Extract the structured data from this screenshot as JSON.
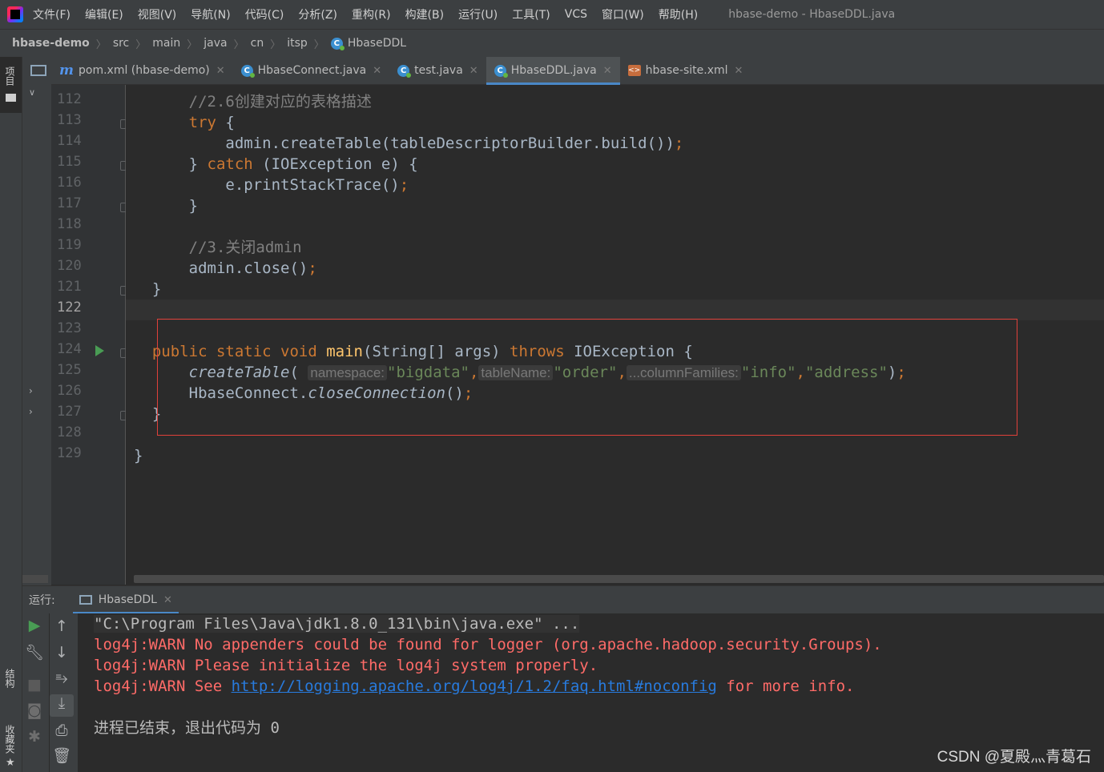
{
  "menu": {
    "items": [
      "文件(F)",
      "编辑(E)",
      "视图(V)",
      "导航(N)",
      "代码(C)",
      "分析(Z)",
      "重构(R)",
      "构建(B)",
      "运行(U)",
      "工具(T)",
      "VCS",
      "窗口(W)",
      "帮助(H)"
    ],
    "window_title": "hbase-demo - HbaseDDL.java"
  },
  "breadcrumb": {
    "root": "hbase-demo",
    "parts": [
      "src",
      "main",
      "java",
      "cn",
      "itsp"
    ],
    "current": "HbaseDDL"
  },
  "left_strip": {
    "project": "项目",
    "structure": "结构",
    "favorites": "收藏夹"
  },
  "tabs": [
    {
      "label": "pom.xml (hbase-demo)",
      "icon": "maven-icon"
    },
    {
      "label": "HbaseConnect.java",
      "icon": "class-icon"
    },
    {
      "label": "test.java",
      "icon": "class-icon"
    },
    {
      "label": "HbaseDDL.java",
      "icon": "class-icon",
      "active": true
    },
    {
      "label": "hbase-site.xml",
      "icon": "xml-icon"
    }
  ],
  "editor": {
    "line_numbers": [
      "112",
      "113",
      "114",
      "115",
      "116",
      "117",
      "118",
      "119",
      "120",
      "121",
      "122",
      "123",
      "124",
      "125",
      "126",
      "127",
      "128",
      "129"
    ],
    "current_line": "122",
    "lines": {
      "l112": "//2.6创建对应的表格描述",
      "l113_kw": "try",
      "l113_rest": " {",
      "l114": "admin.createTable(tableDescriptorBuilder.build())",
      "l114_semi": ";",
      "l115_a": "} ",
      "l115_kw": "catch",
      "l115_b": " (IOException e) {",
      "l116": "e.printStackTrace()",
      "l116_semi": ";",
      "l117": "}",
      "l119": "//3.关闭admin",
      "l120": "admin.close()",
      "l120_semi": ";",
      "l121": "}",
      "l124_kw1": "public static void ",
      "l124_fn": "main",
      "l124_mid": "(String[] args) ",
      "l124_kw2": "throws",
      "l124_end": " IOException {",
      "l125_fn": "createTable",
      "l125_open": "(",
      "l125_hint1": "namespace:",
      "l125_s1": "\"bigdata\"",
      "l125_comma1": ",",
      "l125_hint2": "tableName:",
      "l125_s2": "\"order\"",
      "l125_comma2": ",",
      "l125_hint3": "...columnFamilies:",
      "l125_s3": "\"info\"",
      "l125_comma3": ",",
      "l125_s4": "\"address\"",
      "l125_close": ")",
      "l125_semi": ";",
      "l126_a": "HbaseConnect.",
      "l126_fn": "closeConnection",
      "l126_b": "()",
      "l126_semi": ";",
      "l127": "}",
      "l129": "}"
    }
  },
  "run_panel": {
    "label": "运行:",
    "tab": "HbaseDDL",
    "console": {
      "cmd": "\"C:\\Program Files\\Java\\jdk1.8.0_131\\bin\\java.exe\" ...",
      "warn1": "log4j:WARN No appenders could be found for logger (org.apache.hadoop.security.Groups).",
      "warn2": "log4j:WARN Please initialize the log4j system properly.",
      "warn3_pre": "log4j:WARN See ",
      "warn3_link": "http://logging.apache.org/log4j/1.2/faq.html#noconfig",
      "warn3_post": " for more info.",
      "exit": "进程已结束，退出代码为 0"
    }
  },
  "watermark": "CSDN @夏殿灬青葛石",
  "colors": {
    "keyword": "#cc7832",
    "string": "#6a8759",
    "comment": "#808080",
    "method": "#ffc66d",
    "error": "#ff6b68",
    "link": "#287bde",
    "highlight_box": "#e0403a"
  }
}
